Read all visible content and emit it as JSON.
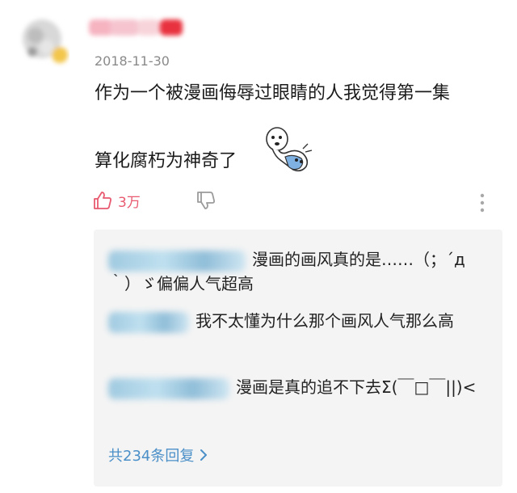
{
  "comment": {
    "date": "2018-11-30",
    "text_line1": "作为一个被漫画侮辱过眼睛的人我觉得第一集",
    "text_line2": "算化腐朽为神奇了",
    "likes": "3万"
  },
  "replies": [
    {
      "text": "漫画的画风真的是……（；´д｀）ゞ偏偏人气超高"
    },
    {
      "text": "我不太懂为什么那个画风人气那么高"
    },
    {
      "text": "漫画是真的追不下去Σ(￣□￣||)<"
    }
  ],
  "more_replies_label": "共234条回复",
  "colors": {
    "like": "#e85a70",
    "link": "#4a8fc8",
    "reply_bg": "#f4f4f4",
    "date": "#8a8a8a"
  },
  "icons": [
    "thumbs-up-icon",
    "thumbs-down-icon",
    "more-vertical-icon",
    "chevron-right-icon",
    "sticker-icon"
  ]
}
